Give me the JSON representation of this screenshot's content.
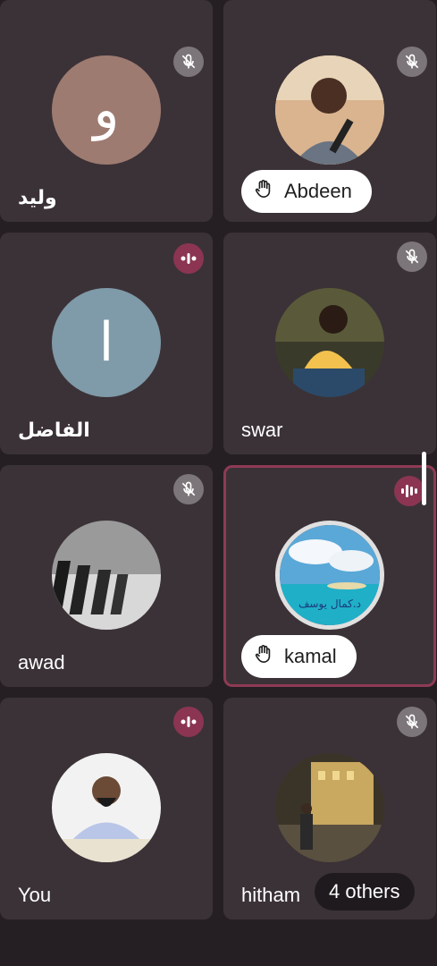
{
  "participants": [
    {
      "name": "وليد",
      "initial": "و",
      "avatar_color": "#9e7b71",
      "muted": true,
      "speaking": false,
      "hand_raised": false
    },
    {
      "name": "Abdeen",
      "avatar_type": "photo",
      "muted": true,
      "speaking": false,
      "hand_raised": true
    },
    {
      "name": "الفاضل",
      "initial": "ا",
      "avatar_color": "#7f9aa8",
      "muted": false,
      "speaking": true,
      "hand_raised": false
    },
    {
      "name": "swar",
      "avatar_type": "photo",
      "muted": true,
      "speaking": false,
      "hand_raised": false
    },
    {
      "name": "awad",
      "avatar_type": "photo",
      "muted": true,
      "speaking": false,
      "hand_raised": false
    },
    {
      "name": "kamal",
      "avatar_type": "photo",
      "avatar_text": "د.كمال يوسف",
      "muted": false,
      "speaking": true,
      "hand_raised": true,
      "active": true
    },
    {
      "name": "You",
      "avatar_type": "photo",
      "muted": false,
      "speaking": true,
      "hand_raised": false
    },
    {
      "name": "hitham",
      "avatar_type": "photo",
      "muted": true,
      "speaking": false,
      "hand_raised": false
    }
  ],
  "others_label": "4 others",
  "colors": {
    "background": "#251f23",
    "tile": "#3b3237",
    "speaking_badge": "#8b3552",
    "muted_badge": "#7c7579",
    "active_border": "#8e3b55"
  }
}
